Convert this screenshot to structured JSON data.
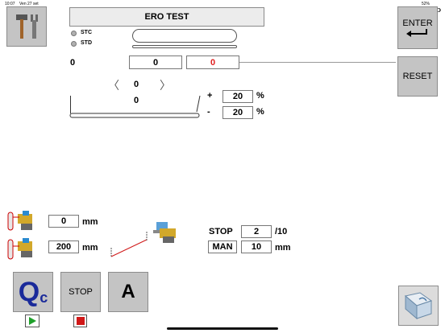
{
  "statusbar": {
    "time": "10:07",
    "date": "Ven 27 set",
    "battery": "52%"
  },
  "header": {
    "title": "ERO TEST"
  },
  "options": [
    {
      "label": "STC"
    },
    {
      "label": "STD"
    }
  ],
  "row_values": {
    "left": "0",
    "field_a": "0",
    "field_b": "0"
  },
  "selector": {
    "value": "0",
    "value2": "0"
  },
  "tolerance": {
    "plus_sign": "+",
    "plus_value": "20",
    "plus_unit": "%",
    "minus_sign": "-",
    "minus_value": "20",
    "minus_unit": "%"
  },
  "right_buttons": {
    "enter_label": "ENTER",
    "reset_label": "RESET"
  },
  "positions": [
    {
      "value": "0",
      "unit": "mm"
    },
    {
      "value": "200",
      "unit": "mm"
    }
  ],
  "controls": {
    "stop_label": "STOP",
    "stop_value": "2",
    "stop_unit": "/10",
    "man_label": "MAN",
    "man_value": "10",
    "man_unit": "mm"
  },
  "bottom_buttons": {
    "qc_q": "Q",
    "qc_c": "c",
    "stop_label": "STOP",
    "a_label": "A"
  },
  "colors": {
    "accent_blue": "#1a2a9a",
    "play_green": "#1ea02a",
    "stop_red": "#d01818",
    "value_red": "#e02020"
  }
}
